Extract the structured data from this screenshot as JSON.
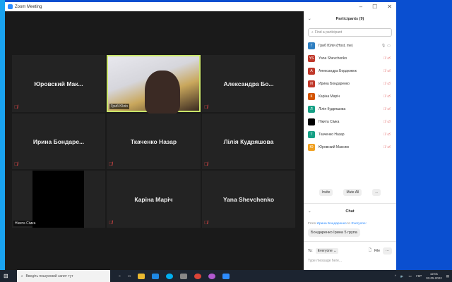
{
  "window": {
    "title": "Zoom Meeting",
    "controls": [
      "–",
      "☐",
      "✕"
    ]
  },
  "tiles": [
    {
      "name": "Юровский Мак...",
      "type": "name"
    },
    {
      "name": "Гриб Юлія",
      "type": "video"
    },
    {
      "name": "Александра Бо...",
      "type": "name"
    },
    {
      "name": "Ирина Бондаре...",
      "type": "name"
    },
    {
      "name": "Ткаченко Назар",
      "type": "name"
    },
    {
      "name": "Лілія Кудряшова",
      "type": "name"
    },
    {
      "name": "Нікита Сімка",
      "type": "black"
    },
    {
      "name": "Каріна Маріч",
      "type": "name"
    },
    {
      "name": "Yana Shevchenko",
      "type": "name"
    }
  ],
  "participants": {
    "title": "Participants (9)",
    "search_placeholder": "Find a participant",
    "items": [
      {
        "initials": "Г",
        "name": "Гриб Юлія (Host, me)",
        "color": "#2f7fc1"
      },
      {
        "initials": "YS",
        "name": "Yana Shevchenko",
        "color": "#c0392b"
      },
      {
        "initials": "А",
        "name": "Александра Бордюжюк",
        "color": "#c0392b"
      },
      {
        "initials": "И",
        "name": "Ирина Бондаренко",
        "color": "#c0392b"
      },
      {
        "initials": "К",
        "name": "Каріна Маріч",
        "color": "#d35400"
      },
      {
        "initials": "Л",
        "name": "Лілія Кудряшова",
        "color": "#16a085"
      },
      {
        "initials": "",
        "name": "Нікита Сімка",
        "color": "#000000"
      },
      {
        "initials": "Т",
        "name": "Ткаченко Назар",
        "color": "#16a085"
      },
      {
        "initials": "Ю",
        "name": "Юровский Максим",
        "color": "#f0a020"
      }
    ],
    "invite": "Invite",
    "mute_all": "Mute All",
    "more": "..."
  },
  "chat": {
    "title": "Chat",
    "from_label": "From",
    "from": "Ирина Бондаренко",
    "to_word": "to",
    "to_target": "Everyone:",
    "message": "Бондаренко Ірина 5 група",
    "to_label": "To:",
    "recipient": "Everyone",
    "file": "File",
    "placeholder": "Type message here..."
  },
  "taskbar": {
    "search": "Введіть пошуковий запит тут",
    "lang": "УКР",
    "time": "12:01",
    "date": "03.05.2022"
  }
}
